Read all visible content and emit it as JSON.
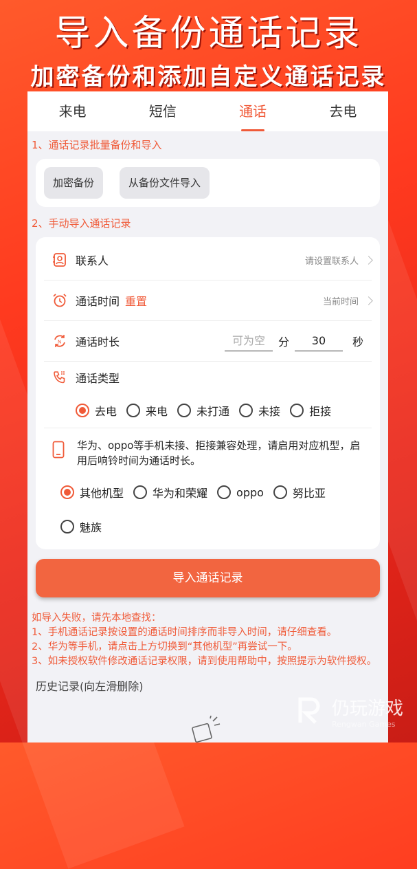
{
  "promo": {
    "title": "导入备份通话记录",
    "subtitle": "加密备份和添加自定义通话记录"
  },
  "tabs": [
    {
      "label": "来电"
    },
    {
      "label": "短信"
    },
    {
      "label": "通话"
    },
    {
      "label": "去电"
    }
  ],
  "section1": {
    "title": "1、通话记录批量备份和导入",
    "encrypt_backup": "加密备份",
    "import_from_file": "从备份文件导入"
  },
  "section2": {
    "title": "2、手动导入通话记录",
    "contact": {
      "label": "联系人",
      "value": "请设置联系人"
    },
    "call_time": {
      "label": "通话时间",
      "reset": "重置",
      "value": "当前时间"
    },
    "duration": {
      "label": "通话时长",
      "minutes_placeholder": "可为空",
      "minutes_unit": "分",
      "seconds_value": "30",
      "seconds_unit": "秒"
    },
    "call_type": {
      "label": "通话类型",
      "options": [
        "去电",
        "来电",
        "未打通",
        "未接",
        "拒接"
      ],
      "selected": "去电"
    },
    "note": "华为、oppo等手机未接、拒接兼容处理，请启用对应机型，启用后响铃时间为通话时长。",
    "models": {
      "options": [
        "其他机型",
        "华为和荣耀",
        "oppo",
        "努比亚",
        "魅族"
      ],
      "selected": "其他机型"
    }
  },
  "import_button": "导入通话记录",
  "warnings": [
    "如导入失败，请先本地查找：",
    "1、手机通话记录按设置的通话时间排序而非导入时间，请仔细查看。",
    "2、华为等手机，请点击上方切换到“其他机型”再尝试一下。",
    "3、如未授权软件修改通话记录权限，请到使用帮助中，按照提示为软件授权。"
  ],
  "history_title": "历史记录(向左滑删除)",
  "watermark": {
    "name": "仍玩游戏",
    "en": "Rengwan Games"
  },
  "colors": {
    "accent": "#f05a38",
    "button": "#f26540"
  }
}
